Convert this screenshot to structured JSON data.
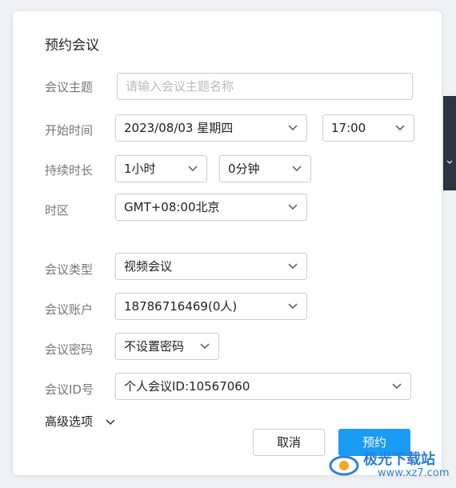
{
  "dialog": {
    "title": "预约会议",
    "subject": {
      "label": "会议主题",
      "placeholder": "请输入会议主题名称"
    },
    "start_time": {
      "label": "开始时间",
      "date": "2023/08/03 星期四",
      "time": "17:00"
    },
    "duration": {
      "label": "持续时长",
      "hours": "1小时",
      "minutes": "0分钟"
    },
    "timezone": {
      "label": "时区",
      "value": "GMT+08:00北京"
    },
    "meeting_type": {
      "label": "会议类型",
      "value": "视频会议"
    },
    "account": {
      "label": "会议账户",
      "value": "18786716469(0人)"
    },
    "password": {
      "label": "会议密码",
      "value": "不设置密码"
    },
    "meeting_id": {
      "label": "会议ID号",
      "value": "个人会议ID:10567060"
    },
    "advanced": {
      "label": "高级选项"
    },
    "buttons": {
      "cancel": "取消",
      "book": "预约"
    }
  },
  "watermark": {
    "brand": "极光下载站",
    "url": "www.xz7.com"
  },
  "colors": {
    "accent": "#1a9bf5",
    "border": "#c9ccd1",
    "label": "#777777"
  }
}
